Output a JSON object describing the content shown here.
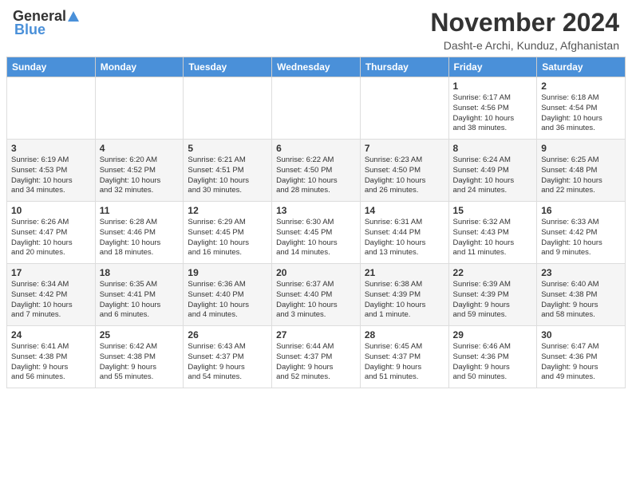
{
  "header": {
    "logo_general": "General",
    "logo_blue": "Blue",
    "title": "November 2024",
    "subtitle": "Dasht-e Archi, Kunduz, Afghanistan"
  },
  "calendar": {
    "columns": [
      "Sunday",
      "Monday",
      "Tuesday",
      "Wednesday",
      "Thursday",
      "Friday",
      "Saturday"
    ],
    "weeks": [
      [
        {
          "day": "",
          "info": ""
        },
        {
          "day": "",
          "info": ""
        },
        {
          "day": "",
          "info": ""
        },
        {
          "day": "",
          "info": ""
        },
        {
          "day": "",
          "info": ""
        },
        {
          "day": "1",
          "info": "Sunrise: 6:17 AM\nSunset: 4:56 PM\nDaylight: 10 hours\nand 38 minutes."
        },
        {
          "day": "2",
          "info": "Sunrise: 6:18 AM\nSunset: 4:54 PM\nDaylight: 10 hours\nand 36 minutes."
        }
      ],
      [
        {
          "day": "3",
          "info": "Sunrise: 6:19 AM\nSunset: 4:53 PM\nDaylight: 10 hours\nand 34 minutes."
        },
        {
          "day": "4",
          "info": "Sunrise: 6:20 AM\nSunset: 4:52 PM\nDaylight: 10 hours\nand 32 minutes."
        },
        {
          "day": "5",
          "info": "Sunrise: 6:21 AM\nSunset: 4:51 PM\nDaylight: 10 hours\nand 30 minutes."
        },
        {
          "day": "6",
          "info": "Sunrise: 6:22 AM\nSunset: 4:50 PM\nDaylight: 10 hours\nand 28 minutes."
        },
        {
          "day": "7",
          "info": "Sunrise: 6:23 AM\nSunset: 4:50 PM\nDaylight: 10 hours\nand 26 minutes."
        },
        {
          "day": "8",
          "info": "Sunrise: 6:24 AM\nSunset: 4:49 PM\nDaylight: 10 hours\nand 24 minutes."
        },
        {
          "day": "9",
          "info": "Sunrise: 6:25 AM\nSunset: 4:48 PM\nDaylight: 10 hours\nand 22 minutes."
        }
      ],
      [
        {
          "day": "10",
          "info": "Sunrise: 6:26 AM\nSunset: 4:47 PM\nDaylight: 10 hours\nand 20 minutes."
        },
        {
          "day": "11",
          "info": "Sunrise: 6:28 AM\nSunset: 4:46 PM\nDaylight: 10 hours\nand 18 minutes."
        },
        {
          "day": "12",
          "info": "Sunrise: 6:29 AM\nSunset: 4:45 PM\nDaylight: 10 hours\nand 16 minutes."
        },
        {
          "day": "13",
          "info": "Sunrise: 6:30 AM\nSunset: 4:45 PM\nDaylight: 10 hours\nand 14 minutes."
        },
        {
          "day": "14",
          "info": "Sunrise: 6:31 AM\nSunset: 4:44 PM\nDaylight: 10 hours\nand 13 minutes."
        },
        {
          "day": "15",
          "info": "Sunrise: 6:32 AM\nSunset: 4:43 PM\nDaylight: 10 hours\nand 11 minutes."
        },
        {
          "day": "16",
          "info": "Sunrise: 6:33 AM\nSunset: 4:42 PM\nDaylight: 10 hours\nand 9 minutes."
        }
      ],
      [
        {
          "day": "17",
          "info": "Sunrise: 6:34 AM\nSunset: 4:42 PM\nDaylight: 10 hours\nand 7 minutes."
        },
        {
          "day": "18",
          "info": "Sunrise: 6:35 AM\nSunset: 4:41 PM\nDaylight: 10 hours\nand 6 minutes."
        },
        {
          "day": "19",
          "info": "Sunrise: 6:36 AM\nSunset: 4:40 PM\nDaylight: 10 hours\nand 4 minutes."
        },
        {
          "day": "20",
          "info": "Sunrise: 6:37 AM\nSunset: 4:40 PM\nDaylight: 10 hours\nand 3 minutes."
        },
        {
          "day": "21",
          "info": "Sunrise: 6:38 AM\nSunset: 4:39 PM\nDaylight: 10 hours\nand 1 minute."
        },
        {
          "day": "22",
          "info": "Sunrise: 6:39 AM\nSunset: 4:39 PM\nDaylight: 9 hours\nand 59 minutes."
        },
        {
          "day": "23",
          "info": "Sunrise: 6:40 AM\nSunset: 4:38 PM\nDaylight: 9 hours\nand 58 minutes."
        }
      ],
      [
        {
          "day": "24",
          "info": "Sunrise: 6:41 AM\nSunset: 4:38 PM\nDaylight: 9 hours\nand 56 minutes."
        },
        {
          "day": "25",
          "info": "Sunrise: 6:42 AM\nSunset: 4:38 PM\nDaylight: 9 hours\nand 55 minutes."
        },
        {
          "day": "26",
          "info": "Sunrise: 6:43 AM\nSunset: 4:37 PM\nDaylight: 9 hours\nand 54 minutes."
        },
        {
          "day": "27",
          "info": "Sunrise: 6:44 AM\nSunset: 4:37 PM\nDaylight: 9 hours\nand 52 minutes."
        },
        {
          "day": "28",
          "info": "Sunrise: 6:45 AM\nSunset: 4:37 PM\nDaylight: 9 hours\nand 51 minutes."
        },
        {
          "day": "29",
          "info": "Sunrise: 6:46 AM\nSunset: 4:36 PM\nDaylight: 9 hours\nand 50 minutes."
        },
        {
          "day": "30",
          "info": "Sunrise: 6:47 AM\nSunset: 4:36 PM\nDaylight: 9 hours\nand 49 minutes."
        }
      ]
    ]
  }
}
